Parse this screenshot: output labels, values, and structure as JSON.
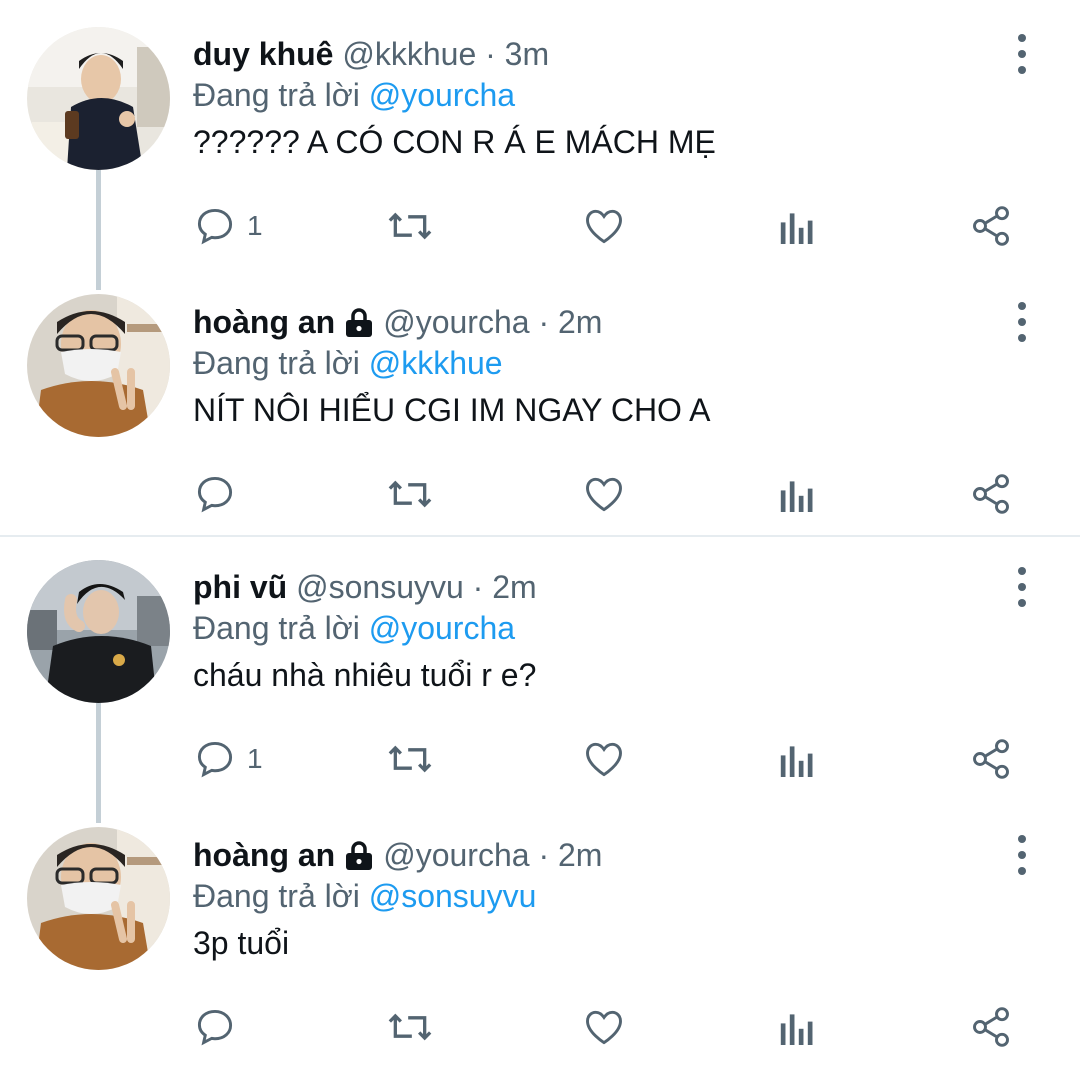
{
  "reply_prefix": "Đang trả lời",
  "colors": {
    "accent": "#1d9bf0",
    "secondary_text": "#536471",
    "thread_line": "#c4cfd6"
  },
  "tweets": [
    {
      "name": "duy khuê",
      "handle": "@kkkhue",
      "dot": "·",
      "time": "3m",
      "locked": false,
      "reply_to": "@yourcha",
      "text": "?????? A CÓ CON R Á E MÁCH MẸ",
      "reply_count": "1",
      "icons": [
        "comment-icon",
        "retweet-icon",
        "like-icon",
        "analytics-icon",
        "share-icon"
      ]
    },
    {
      "name": "hoàng an",
      "handle": "@yourcha",
      "dot": "·",
      "time": "2m",
      "locked": true,
      "reply_to": "@kkkhue",
      "text": "NÍT NÔI HIỂU CGI IM NGAY CHO A",
      "reply_count": "",
      "icons": [
        "comment-icon",
        "retweet-icon",
        "like-icon",
        "analytics-icon",
        "share-icon"
      ]
    },
    {
      "name": "phi vũ",
      "handle": "@sonsuyvu",
      "dot": "·",
      "time": "2m",
      "locked": false,
      "reply_to": "@yourcha",
      "text": "cháu nhà nhiêu tuổi r e?",
      "reply_count": "1",
      "icons": [
        "comment-icon",
        "retweet-icon",
        "like-icon",
        "analytics-icon",
        "share-icon"
      ]
    },
    {
      "name": "hoàng an",
      "handle": "@yourcha",
      "dot": "·",
      "time": "2m",
      "locked": true,
      "reply_to": "@sonsuyvu",
      "text": "3p tuổi",
      "reply_count": "",
      "icons": [
        "comment-icon",
        "retweet-icon",
        "like-icon",
        "analytics-icon",
        "share-icon"
      ]
    }
  ]
}
